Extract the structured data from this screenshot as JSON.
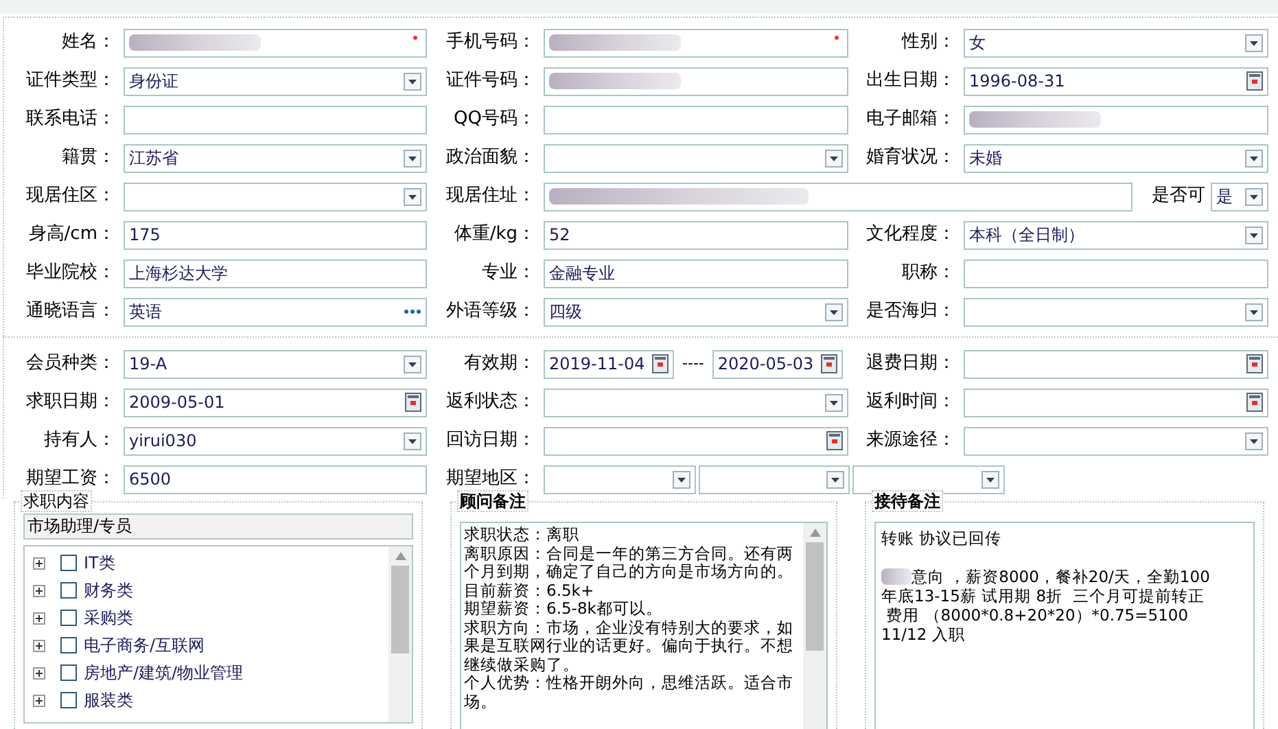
{
  "sections": [
    {
      "rows": [
        [
          {
            "label": "姓名：",
            "field": {
              "kind": "text",
              "redacted": true,
              "required": true
            }
          },
          {
            "label": "手机号码：",
            "field": {
              "kind": "text",
              "redacted": true,
              "required": true
            }
          },
          {
            "label": "性别：",
            "field": {
              "kind": "select",
              "value": "女",
              "redacted": false,
              "required": false
            }
          }
        ],
        [
          {
            "label": "证件类型：",
            "field": {
              "kind": "select",
              "value": "身份证",
              "redacted": false,
              "required": false
            }
          },
          {
            "label": "证件号码：",
            "field": {
              "kind": "text",
              "redacted": true,
              "required": false
            }
          },
          {
            "label": "出生日期：",
            "field": {
              "kind": "date",
              "value": "1996-08-31",
              "redacted": false,
              "required": false
            }
          }
        ],
        [
          {
            "label": "联系电话：",
            "field": {
              "kind": "text",
              "redacted": false,
              "required": false
            }
          },
          {
            "label": "QQ号码：",
            "field": {
              "kind": "text",
              "redacted": false,
              "required": false
            }
          },
          {
            "label": "电子邮箱：",
            "field": {
              "kind": "text",
              "redacted": true,
              "required": false
            }
          }
        ],
        [
          {
            "label": "籍贯：",
            "field": {
              "kind": "select",
              "value": "江苏省",
              "redacted": false,
              "required": false
            }
          },
          {
            "label": "政治面貌：",
            "field": {
              "kind": "select",
              "redacted": false,
              "required": false
            }
          },
          {
            "label": "婚育状况：",
            "field": {
              "kind": "select",
              "value": "未婚",
              "redacted": false,
              "required": false
            }
          }
        ],
        [
          {
            "label": "现居住区：",
            "field": {
              "kind": "select",
              "redacted": false,
              "required": false
            }
          },
          {
            "label": "现居住址：",
            "field": {
              "kind": "text",
              "redacted": true,
              "required": false
            },
            "suffix": {
              "label": "是否可",
              "field": {
                "kind": "select",
                "value": "是",
                "redacted": false,
                "required": false
              }
            }
          }
        ],
        [
          {
            "label": "身高/cm：",
            "field": {
              "kind": "text",
              "value": "175",
              "redacted": false,
              "required": false
            }
          },
          {
            "label": "体重/kg：",
            "field": {
              "kind": "text",
              "value": "52",
              "redacted": false,
              "required": false
            }
          },
          {
            "label": "文化程度：",
            "field": {
              "kind": "select",
              "value": "本科（全日制）",
              "redacted": false,
              "required": false
            }
          }
        ],
        [
          {
            "label": "毕业院校：",
            "field": {
              "kind": "text",
              "value": "上海杉达大学",
              "redacted": false,
              "required": false
            }
          },
          {
            "label": "专业：",
            "field": {
              "kind": "text",
              "value": "金融专业",
              "redacted": false,
              "required": false
            }
          },
          {
            "label": "职称：",
            "field": {
              "kind": "text",
              "redacted": false,
              "required": false
            }
          }
        ],
        [
          {
            "label": "通晓语言：",
            "field": {
              "kind": "lookup",
              "value": "英语",
              "redacted": false,
              "required": false
            }
          },
          {
            "label": "外语等级：",
            "field": {
              "kind": "select",
              "value": "四级",
              "redacted": false,
              "required": false
            }
          },
          {
            "label": "是否海归：",
            "field": {
              "kind": "select",
              "redacted": false,
              "required": false
            }
          }
        ]
      ]
    },
    {
      "rows": [
        [
          {
            "label": "会员种类：",
            "field": {
              "kind": "select",
              "value": "19-A",
              "redacted": false,
              "required": false
            }
          },
          {
            "label": "有效期：",
            "field": {
              "kind": "range",
              "from": "2019-11-04",
              "separator": "----",
              "to": "2020-05-03"
            }
          },
          {
            "label": "退费日期：",
            "field": {
              "kind": "date",
              "redacted": false,
              "required": false
            }
          }
        ],
        [
          {
            "label": "求职日期：",
            "field": {
              "kind": "date",
              "value": "2009-05-01",
              "redacted": false,
              "required": false
            }
          },
          {
            "label": "返利状态：",
            "field": {
              "kind": "select",
              "redacted": false,
              "required": false
            }
          },
          {
            "label": "返利时间：",
            "field": {
              "kind": "date",
              "redacted": false,
              "required": false
            }
          }
        ],
        [
          {
            "label": "持有人：",
            "field": {
              "kind": "select",
              "value": "yirui030",
              "redacted": false,
              "required": false
            }
          },
          {
            "label": "回访日期：",
            "field": {
              "kind": "date",
              "redacted": false,
              "required": false
            }
          },
          {
            "label": "来源途径：",
            "field": {
              "kind": "select",
              "redacted": false,
              "required": false
            }
          }
        ],
        [
          {
            "label": "期望工资：",
            "field": {
              "kind": "text",
              "value": "6500",
              "redacted": false,
              "required": false
            }
          },
          {
            "label": "期望地区：",
            "field": {
              "kind": "multi",
              "parts": [
                {
                  "kind": "select"
                },
                {
                  "kind": "select"
                },
                {
                  "kind": "select"
                }
              ]
            }
          }
        ]
      ]
    }
  ],
  "job_panel": {
    "title": "求职内容",
    "value": "市场助理/专员",
    "tree": [
      {
        "label": "IT类",
        "checked": false,
        "expanded": false
      },
      {
        "label": "财务类",
        "checked": false,
        "expanded": false
      },
      {
        "label": "采购类",
        "checked": false,
        "expanded": false
      },
      {
        "label": "电子商务/互联网",
        "checked": false,
        "expanded": false
      },
      {
        "label": "房地产/建筑/物业管理",
        "checked": false,
        "expanded": false
      },
      {
        "label": "服装类",
        "checked": false,
        "expanded": false
      }
    ]
  },
  "advisor_notes": {
    "title": "顾问备注",
    "lines": [
      "求职状态：离职",
      "离职原因：合同是一年的第三方合同。还有两个月到期，确定了自己的方向是市场方向的。",
      "目前薪资：6.5k+",
      "期望薪资：6.5-8k都可以。",
      "求职方向：市场，企业没有特别大的要求，如果是互联网行业的话更好。偏向于执行。不想继续做采购了。",
      "个人优势：性格开朗外向，思维活跃。适合市场。"
    ]
  },
  "reception_notes": {
    "title": "接待备注",
    "lines": [
      {
        "text": "转账 协议已回传",
        "redacted": false
      },
      {
        "redacted": false
      },
      {
        "text": "意向 ，薪资8000，餐补20/天，全勤100",
        "redacted": true
      },
      {
        "text": "年底13-15薪 试用期 8折  三个月可提前转正",
        "redacted": false
      },
      {
        "text": " 费用 （8000*0.8+20*20）*0.75=5100",
        "redacted": false
      },
      {
        "text": "11/12 入职",
        "redacted": false
      }
    ]
  }
}
